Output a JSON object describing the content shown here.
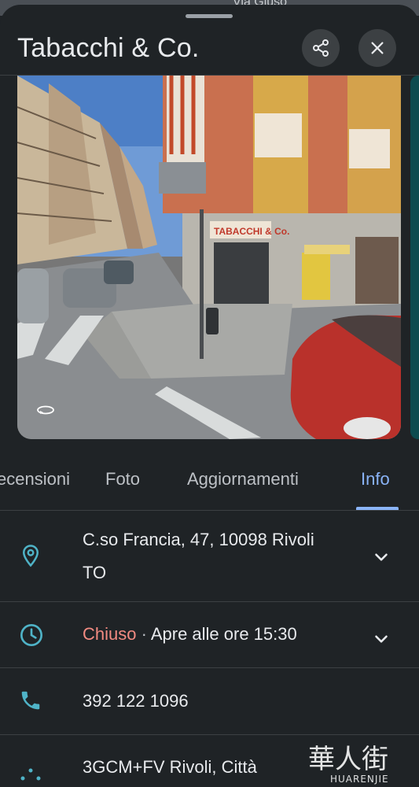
{
  "map_peek": {
    "text": "Via Giuso"
  },
  "header": {
    "title": "Tabacchi & Co.",
    "share_icon": "share-icon",
    "close_icon": "close-icon"
  },
  "photo": {
    "sign_text": "TABACCHI & Co.",
    "pano_icon": "360-view-icon"
  },
  "tabs": [
    {
      "label": "ecensioni",
      "active": false
    },
    {
      "label": "Foto",
      "active": false
    },
    {
      "label": "Aggiornamenti",
      "active": false
    },
    {
      "label": "Info",
      "active": true
    }
  ],
  "info": {
    "address_line1": "C.so Francia, 47, 10098 Rivoli",
    "address_line2": "TO",
    "hours_status": "Chiuso",
    "hours_separator": " · ",
    "hours_detail": "Apre alle ore 15:30",
    "phone": "392 122 1096",
    "plus_code": "3GCM+FV Rivoli, Città"
  },
  "watermark": {
    "chinese": "華人街",
    "latin": "HUARENJIE"
  },
  "colors": {
    "background": "#1f2326",
    "accent": "#8ab4f8",
    "icon_teal": "#81c995",
    "closed_red": "#f28b82"
  }
}
